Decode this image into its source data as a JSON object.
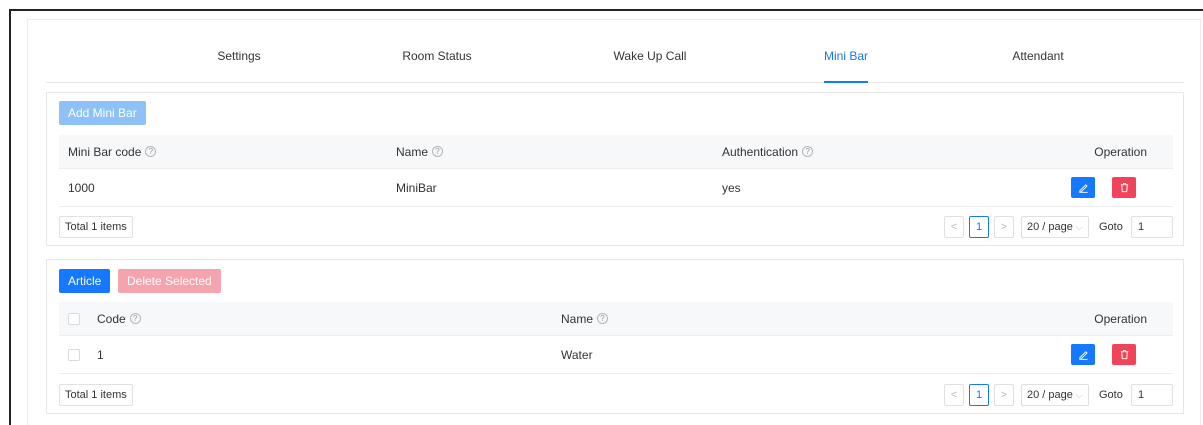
{
  "tabs": [
    {
      "label": "Settings",
      "active": false
    },
    {
      "label": "Room Status",
      "active": false
    },
    {
      "label": "Wake Up Call",
      "active": false
    },
    {
      "label": "Mini Bar",
      "active": true
    },
    {
      "label": "Attendant",
      "active": false
    }
  ],
  "minibar": {
    "add_label": "Add Mini Bar",
    "columns": {
      "code": "Mini Bar code",
      "name": "Name",
      "auth": "Authentication",
      "operation": "Operation"
    },
    "rows": [
      {
        "code": "1000",
        "name": "MiniBar",
        "auth": "yes"
      }
    ],
    "total": "Total 1 items"
  },
  "articles": {
    "article_label": "Article",
    "delete_selected_label": "Delete Selected",
    "columns": {
      "code": "Code",
      "name": "Name",
      "operation": "Operation"
    },
    "rows": [
      {
        "code": "1",
        "name": "Water"
      }
    ],
    "total": "Total 1 items"
  },
  "pagination": {
    "prev": "<",
    "current": "1",
    "next": ">",
    "page_size": "20 / page",
    "goto_label": "Goto",
    "goto_value": "1"
  },
  "colors": {
    "primary": "#1677ff",
    "primary_disabled": "#8ec1f8",
    "danger": "#f0445a",
    "danger_disabled": "#f5a4ae"
  },
  "icons": {
    "help": "question-circle-icon",
    "edit": "pencil-icon",
    "delete": "trash-icon"
  }
}
